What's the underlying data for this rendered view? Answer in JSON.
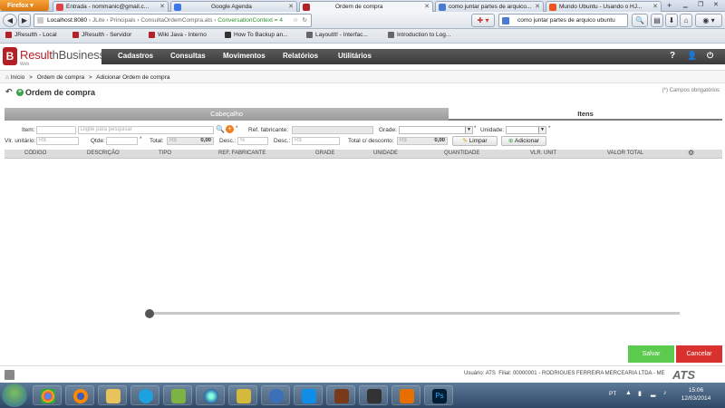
{
  "browser": {
    "menu_label": "Firefox",
    "tabs": [
      {
        "label": "Entrada - nommanic@gmail.c...",
        "icon_color": "#d44"
      },
      {
        "label": "Google Agenda",
        "icon_color": "#3b78e7"
      },
      {
        "label": "Ordem de compra",
        "icon_color": "#b32025"
      },
      {
        "label": "como juntar partes de arquico...",
        "icon_color": "#4a7bd0"
      },
      {
        "label": "Mundo Ubuntu - Usando o HJ...",
        "icon_color": "#e95420"
      }
    ],
    "url": {
      "host": "Localhost:8080",
      "path": " › JLite › Principais › ConsultaOrdemCompra.ats › ",
      "context": "ConversationContext = 4"
    },
    "search_value": "como juntar partes de arquico ubuntu",
    "bookmarks": [
      {
        "label": "JResulth - Local",
        "icon_color": "#b32025"
      },
      {
        "label": "JResulth - Servidor",
        "icon_color": "#b32025"
      },
      {
        "label": "Wiki Java - Interno",
        "icon_color": "#b32025"
      },
      {
        "label": "How To Backup an...",
        "icon_color": "#333"
      },
      {
        "label": "LayoutIt! - Interfac...",
        "icon_color": "#666"
      },
      {
        "label": "Introduction to Log...",
        "icon_color": "#666"
      }
    ]
  },
  "app": {
    "brand_a": "Result",
    "brand_b": "hBusiness",
    "brand_sub": "Web",
    "logo_letter": "B",
    "menu": [
      "Cadastros",
      "Consultas",
      "Movimentos",
      "Relatórios",
      "Utilitários"
    ],
    "header_icons": [
      "help-icon",
      "user-icon",
      "power-icon"
    ]
  },
  "breadcrumb": {
    "items": [
      "Início",
      "Ordem de compra",
      "Adicionar Ordem de compra"
    ],
    "separator": ">"
  },
  "page": {
    "title": "Ordem de compra",
    "required_note": "(*) Campos obrigatórios",
    "tab_header": "Cabeçalho",
    "tab_items": "Itens"
  },
  "form": {
    "item_label": "Item:",
    "item_placeholder": "Digite para pesquisar",
    "ref_fab_label": "Ref. fabricante:",
    "grade_label": "Grade:",
    "unidade_label": "Unidade:",
    "vlr_unit_label": "Vlr. unitário:",
    "vlr_unit_placeholder": "R$",
    "qtde_label": "Qtde:",
    "total_label": "Total:",
    "total_prefix": "R$",
    "total_value": "0,00",
    "desc_pct_label": "Desc.:",
    "desc_pct_placeholder": "%",
    "desc_val_label": "Desc.:",
    "desc_val_placeholder": "R$",
    "total_desc_label": "Total c/ desconto:",
    "total_desc_prefix": "R$",
    "total_desc_value": "0,00",
    "required_mark": "*",
    "clear_button": "Limpar",
    "add_button": "Adicionar"
  },
  "grid": {
    "columns": [
      "CÓDIGO",
      "DESCRIÇÃO",
      "TIPO",
      "REF. FABRICANTE",
      "GRADE",
      "UNIDADE",
      "QUANTIDADE",
      "VLR. UNIT",
      "VALOR TOTAL"
    ]
  },
  "actions": {
    "save": "Salvar",
    "cancel": "Cancelar",
    "save_color": "#5cc94f",
    "cancel_color": "#d9322e"
  },
  "footer": {
    "user_label": "Usuário:",
    "user": "ATS",
    "branch_label": "Filial:",
    "branch": "00000001 - RODRIGUES FERREIRA MERCEARIA LTDA - ME",
    "logo": "ATS"
  },
  "taskbar": {
    "lang": "PT",
    "time": "15:06",
    "date": "12/03/2014"
  }
}
